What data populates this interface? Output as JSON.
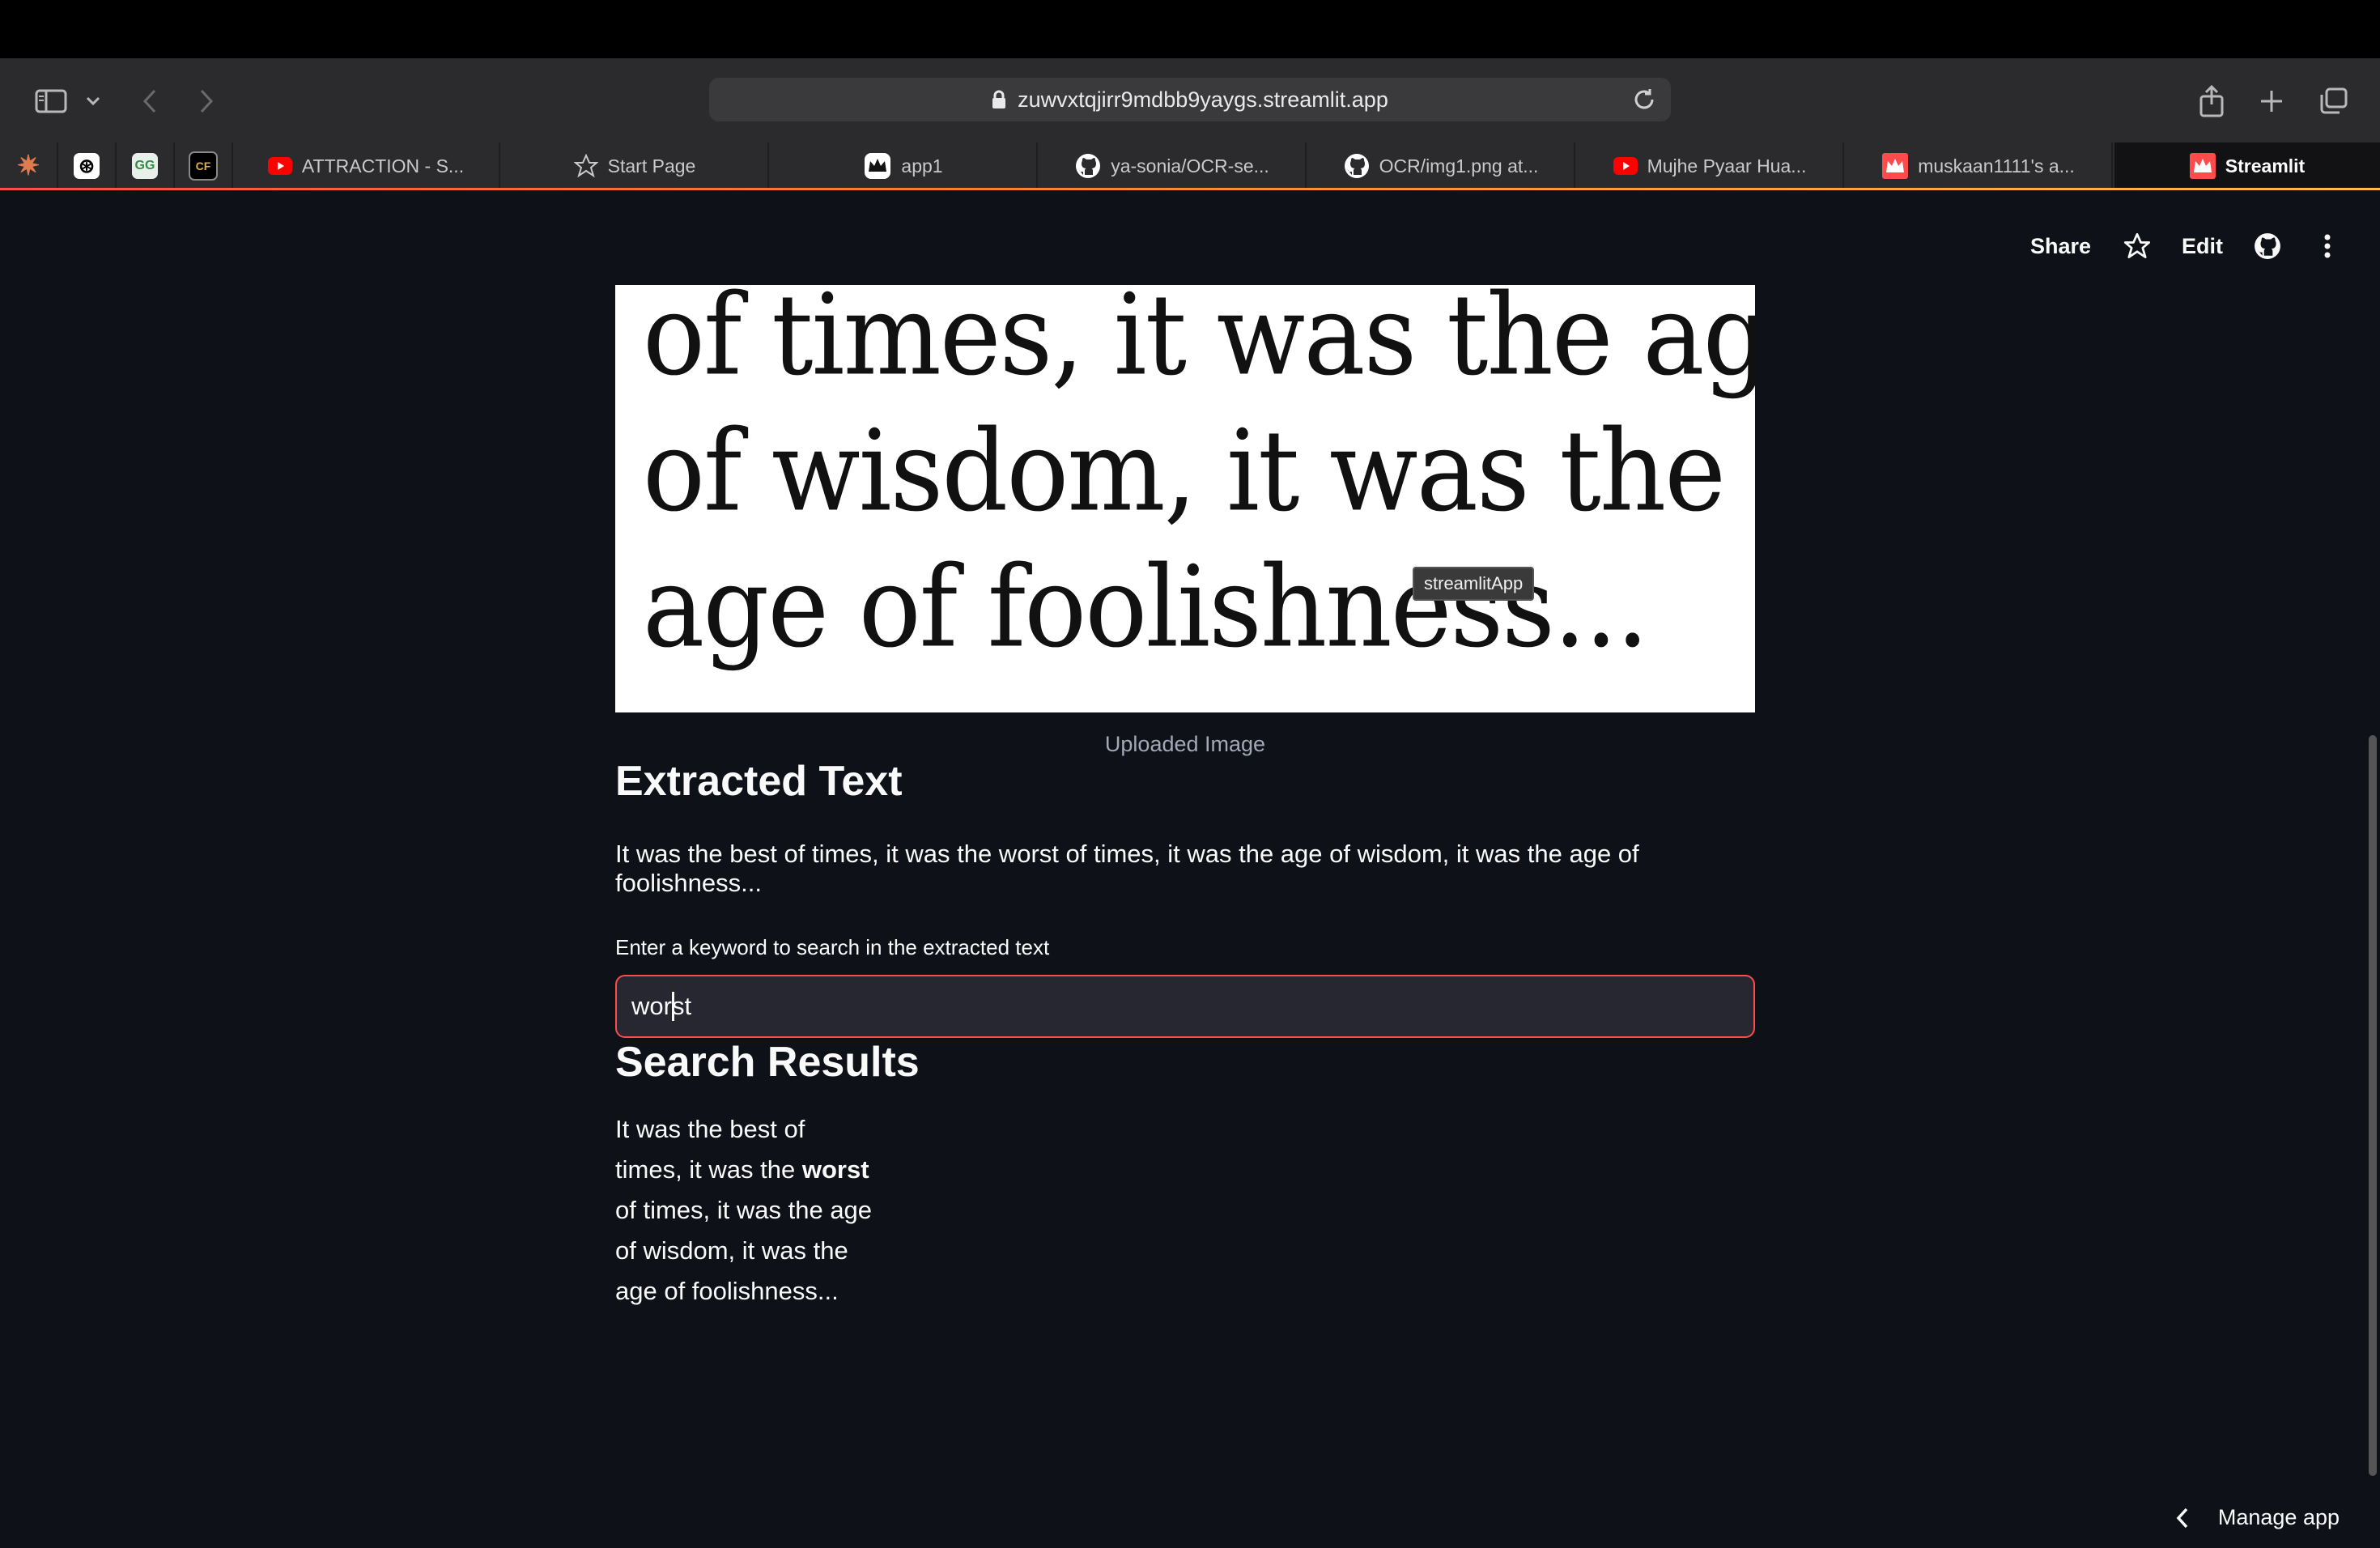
{
  "browser": {
    "url": "zuwvxtqjirr9mdbb9yaygs.streamlit.app",
    "tabs": [
      {
        "label": "ATTRACTION - S...",
        "icon": "youtube-icon"
      },
      {
        "label": "Start Page",
        "icon": "star-icon"
      },
      {
        "label": "app1",
        "icon": "streamlit-crown-icon"
      },
      {
        "label": "ya-sonia/OCR-se...",
        "icon": "github-icon"
      },
      {
        "label": "OCR/img1.png at...",
        "icon": "github-icon"
      },
      {
        "label": "Mujhe Pyaar Hua...",
        "icon": "youtube-icon"
      },
      {
        "label": "muskaan1111's a...",
        "icon": "streamlit-icon"
      },
      {
        "label": "Streamlit",
        "icon": "streamlit-icon"
      }
    ],
    "pinned": [
      {
        "icon": "claude-icon"
      },
      {
        "icon": "chatgpt-icon"
      },
      {
        "icon": "geeksforgeeks-icon",
        "text": "GG"
      },
      {
        "icon": "cf-icon",
        "text": "CF"
      }
    ]
  },
  "app_toolbar": {
    "share_label": "Share",
    "edit_label": "Edit"
  },
  "image": {
    "lines": [
      "of times, it was the age",
      "of wisdom, it was the",
      "age of foolishness..."
    ],
    "tooltip": "streamlitApp",
    "caption": "Uploaded Image"
  },
  "extracted": {
    "title": "Extracted Text",
    "text": "It was the best of times, it was the worst of times, it was the age of wisdom, it was the age of foolishness..."
  },
  "search": {
    "label": "Enter a keyword to search in the extracted text",
    "value_before_caret": "wor",
    "value_after_caret": "st"
  },
  "results": {
    "title": "Search Results",
    "lines": [
      {
        "before": "It was the best of",
        "bold": "",
        "after": ""
      },
      {
        "before": "times, it was the ",
        "bold": "worst",
        "after": ""
      },
      {
        "before": "of times, it was the age",
        "bold": "",
        "after": ""
      },
      {
        "before": "of wisdom, it was the",
        "bold": "",
        "after": ""
      },
      {
        "before": "age of foolishness...",
        "bold": "",
        "after": ""
      }
    ]
  },
  "footer": {
    "manage_label": "Manage app"
  },
  "colors": {
    "background": "#0e1117",
    "accent": "#ff4b4b",
    "input_bg": "#262730"
  }
}
